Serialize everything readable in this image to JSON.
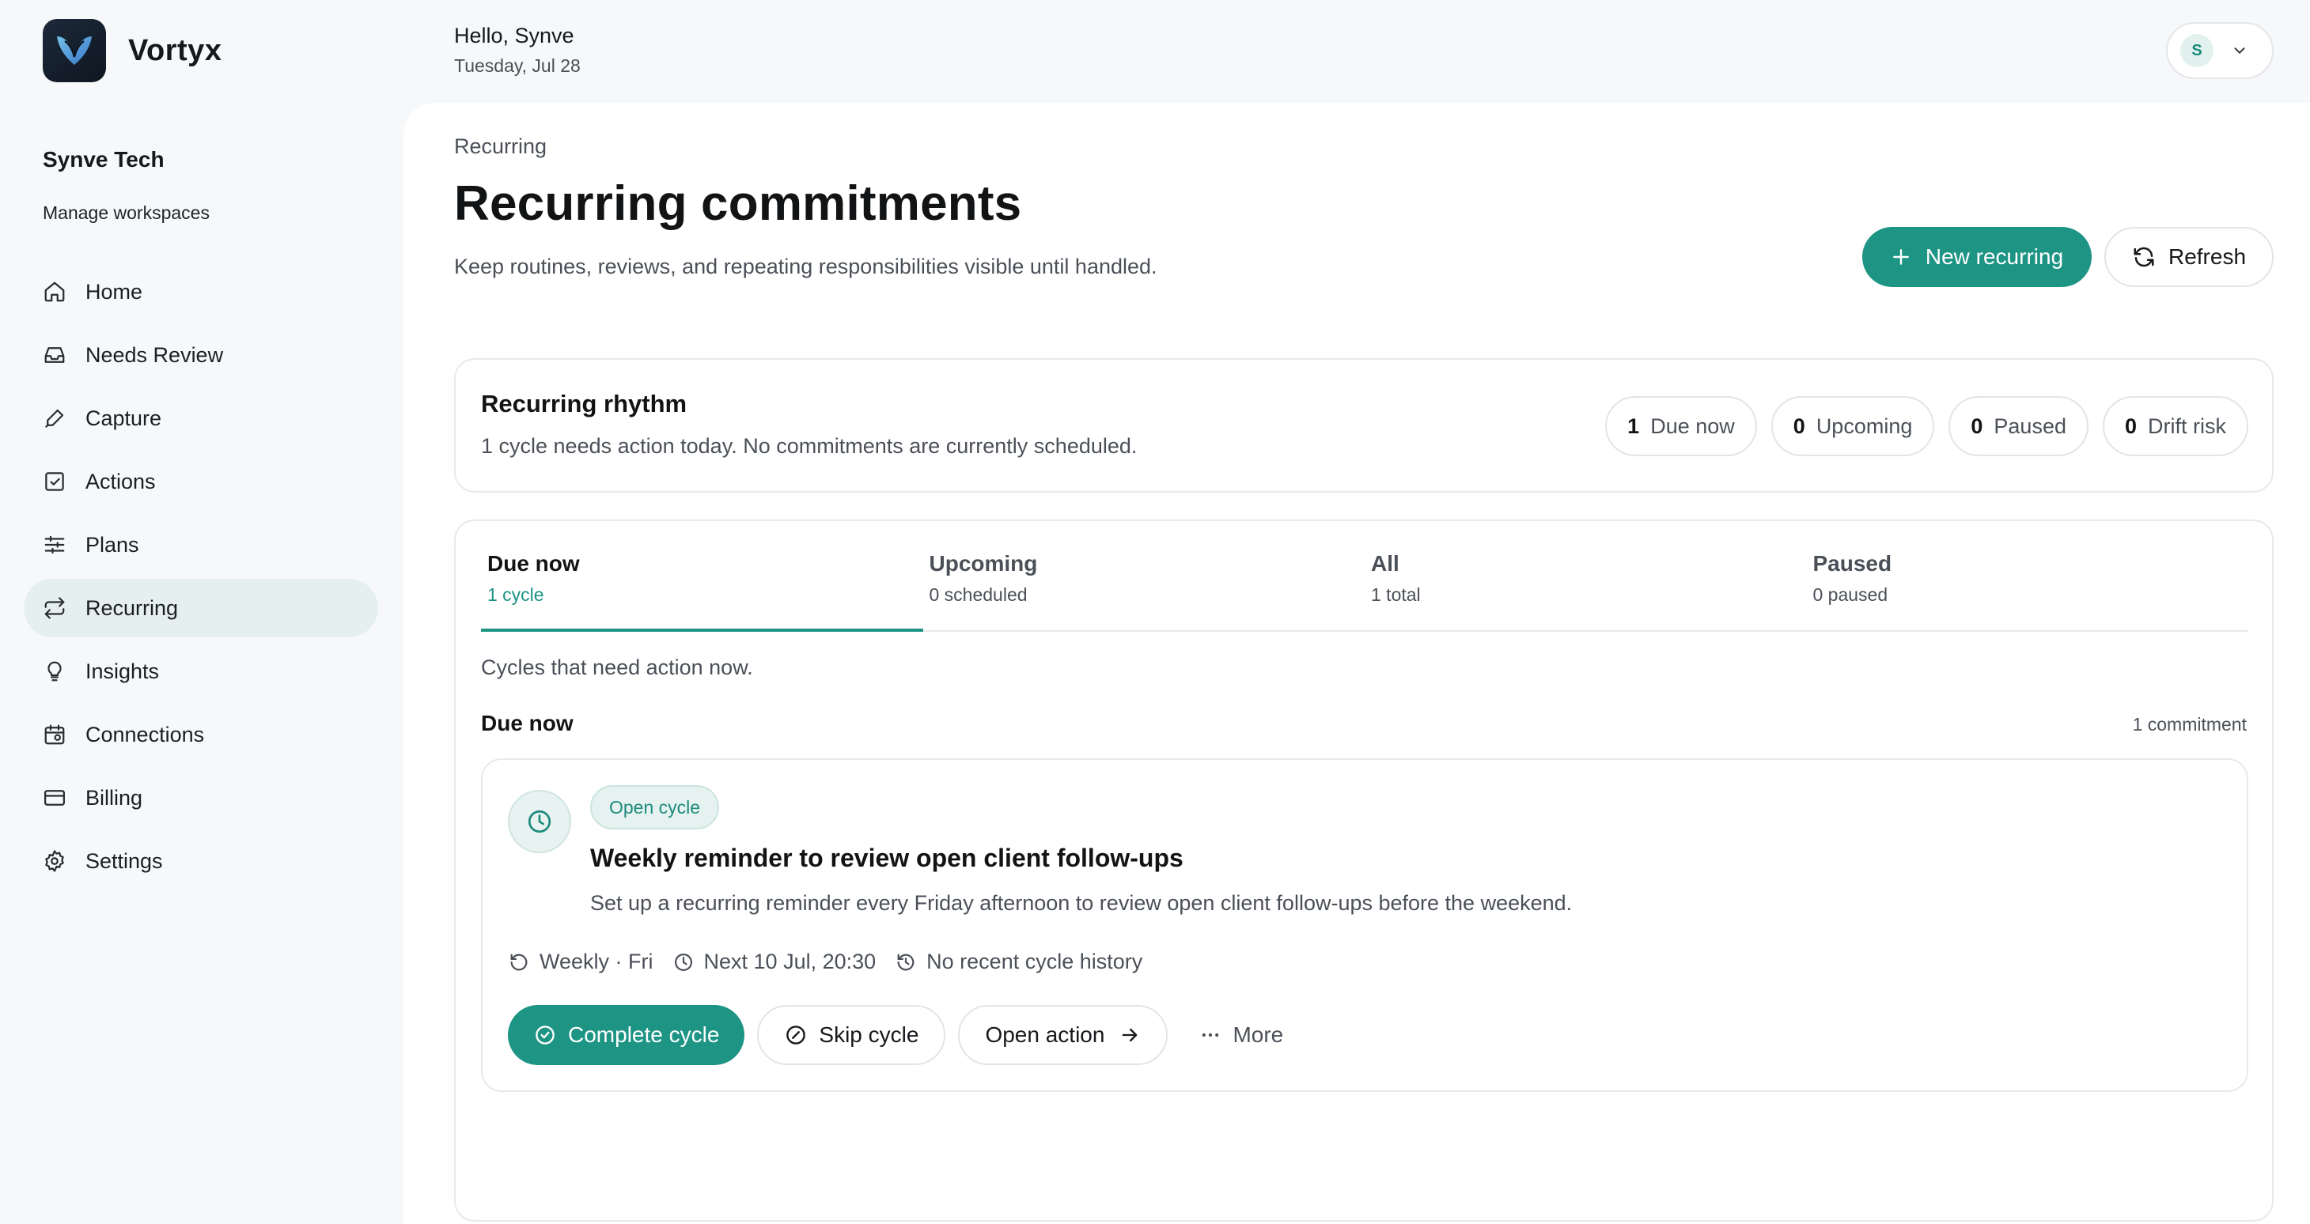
{
  "brand": {
    "name": "Vortyx"
  },
  "workspace": {
    "name": "Synve Tech",
    "manage_label": "Manage workspaces"
  },
  "nav": {
    "items": [
      {
        "label": "Home",
        "icon": "home-icon"
      },
      {
        "label": "Needs Review",
        "icon": "inbox-icon"
      },
      {
        "label": "Capture",
        "icon": "pen-icon"
      },
      {
        "label": "Actions",
        "icon": "checkbox-icon"
      },
      {
        "label": "Plans",
        "icon": "sliders-icon"
      },
      {
        "label": "Recurring",
        "icon": "repeat-icon",
        "active": true
      },
      {
        "label": "Insights",
        "icon": "lightbulb-icon"
      },
      {
        "label": "Connections",
        "icon": "calendar-plug-icon"
      },
      {
        "label": "Billing",
        "icon": "credit-card-icon"
      },
      {
        "label": "Settings",
        "icon": "gear-icon"
      }
    ]
  },
  "topbar": {
    "greeting": "Hello, Synve",
    "date": "Tuesday, Jul 28",
    "avatar_initial": "S"
  },
  "page": {
    "breadcrumb": "Recurring",
    "title": "Recurring commitments",
    "subtitle": "Keep routines, reviews, and repeating responsibilities visible until handled.",
    "new_button": "New recurring",
    "refresh_button": "Refresh"
  },
  "rhythm": {
    "title": "Recurring rhythm",
    "description": "1 cycle needs action today. No commitments are currently scheduled.",
    "stats": [
      {
        "count": "1",
        "label": "Due now"
      },
      {
        "count": "0",
        "label": "Upcoming"
      },
      {
        "count": "0",
        "label": "Paused"
      },
      {
        "count": "0",
        "label": "Drift risk"
      }
    ]
  },
  "tabs": [
    {
      "label": "Due now",
      "count": "1 cycle",
      "active": true
    },
    {
      "label": "Upcoming",
      "count": "0 scheduled"
    },
    {
      "label": "All",
      "count": "1 total"
    },
    {
      "label": "Paused",
      "count": "0 paused"
    }
  ],
  "due": {
    "description": "Cycles that need action now.",
    "section_title": "Due now",
    "section_count": "1 commitment",
    "item": {
      "status": "Open cycle",
      "title": "Weekly reminder to review open client follow-ups",
      "description": "Set up a recurring reminder every Friday afternoon to review open client follow-ups before the weekend.",
      "frequency": "Weekly · Fri",
      "next": "Next 10 Jul, 20:30",
      "history": "No recent cycle history",
      "complete_label": "Complete cycle",
      "skip_label": "Skip cycle",
      "open_label": "Open action",
      "more_label": "More"
    }
  },
  "colors": {
    "accent": "#1e9485",
    "active_nav_bg": "#e5efee",
    "page_bg": "#f7f8f9"
  }
}
